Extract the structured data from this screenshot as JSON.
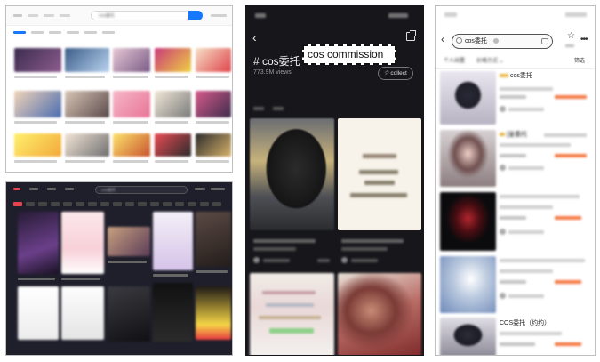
{
  "panel_a": {
    "search_text": "cos委托",
    "search_button": "搜索"
  },
  "panel_b": {
    "search_text": "cos委托"
  },
  "panel_c": {
    "back_symbol": "‹",
    "hashtag": "# cos委托",
    "annotation": "cos commission",
    "views": "773.9M views",
    "collect_label": "collect",
    "collect_star": "☆"
  },
  "panel_d": {
    "back_symbol": "‹",
    "search_text": "cos委托",
    "more_symbol": "•••",
    "filter_chips": [
      "个人闲置",
      "价格方式 ⌄"
    ],
    "filter_label": "筛选",
    "results": [
      {
        "title": "cos委托"
      },
      {
        "title": "[皇委托"
      },
      {
        "title": "COS委托（约约）"
      }
    ]
  },
  "colors": {
    "accent_blue": "#1677ff",
    "dark_bg": "#16161b",
    "price_orange": "#f47a45"
  }
}
